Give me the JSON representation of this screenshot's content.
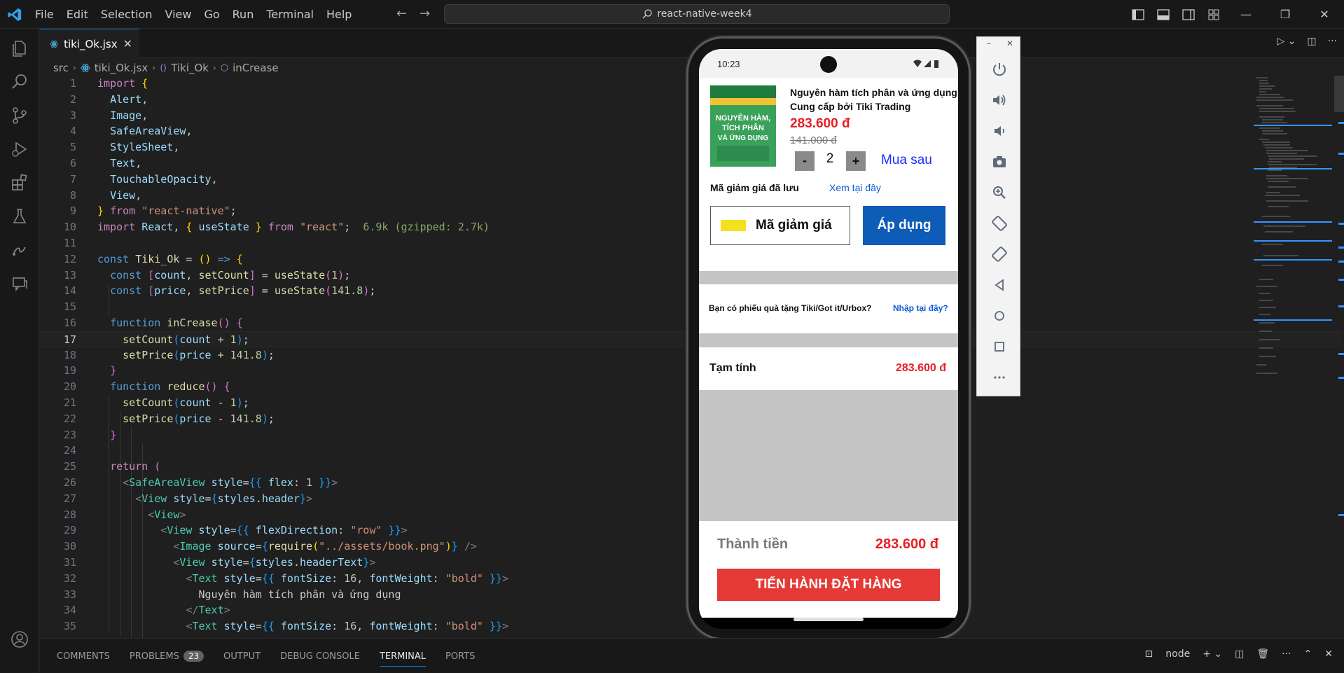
{
  "titlebar": {
    "menu": [
      "File",
      "Edit",
      "Selection",
      "View",
      "Go",
      "Run",
      "Terminal",
      "Help"
    ],
    "search": "react-native-week4"
  },
  "tab": {
    "filename": "tiki_Ok.jsx"
  },
  "breadcrumb": [
    "src",
    "tiki_Ok.jsx",
    "Tiki_Ok",
    "inCrease"
  ],
  "editor": {
    "line_numbers": [
      "1",
      "2",
      "3",
      "4",
      "5",
      "6",
      "7",
      "8",
      "9",
      "10",
      "11",
      "12",
      "13",
      "14",
      "15",
      "16",
      "17",
      "18",
      "19",
      "20",
      "21",
      "22",
      "23",
      "24",
      "25",
      "26",
      "27",
      "28",
      "29",
      "30",
      "31",
      "32",
      "33",
      "34",
      "35"
    ],
    "active_line": 17,
    "import_hint": "6.9k (gzipped: 2.7k)"
  },
  "panel": {
    "tabs": [
      "COMMENTS",
      "PROBLEMS",
      "OUTPUT",
      "DEBUG CONSOLE",
      "TERMINAL",
      "PORTS"
    ],
    "problems_count": "23",
    "active_tab": "TERMINAL",
    "terminal_name": "node"
  },
  "phone": {
    "time": "10:23",
    "product_title": "Nguyên hàm tích phân và ứng dụng",
    "provider": "Cung cấp bởi Tiki Trading",
    "price": "283.600 đ",
    "old_price": "141.000 đ",
    "minus": "-",
    "quantity": "2",
    "plus": "+",
    "buy_later": "Mua sau",
    "saved_coupon_label": "Mã giảm giá đã lưu",
    "saved_coupon_link": "Xem tại đây",
    "coupon_input": "Mã giảm giá",
    "apply_button": "Áp dụng",
    "gift_question": "Bạn có phiếu quà tặng Tiki/Got it/Urbox?",
    "gift_link": "Nhập tại đây?",
    "subtotal_label": "Tạm tính",
    "subtotal_value": "283.600 đ",
    "total_label": "Thành tiền",
    "total_value": "283.600 đ",
    "checkout_button": "TIẾN HÀNH ĐẶT HÀNG",
    "book_cover_title": "NGUYÊN HÀM, TÍCH PHÂN VÀ ỨNG DỤNG",
    "colors": {
      "price_red": "#e81e25",
      "link_blue": "#0d5bd8",
      "apply_blue": "#0d5cb6",
      "checkout_red": "#e53935",
      "coupon_yellow": "#f3e120"
    }
  },
  "emulator_toolbar": [
    "power-icon",
    "volume-up-icon",
    "volume-down-icon",
    "camera-icon",
    "zoom-icon",
    "rotate-left-icon",
    "rotate-right-icon",
    "back-icon",
    "home-icon",
    "overview-icon",
    "more-icon"
  ]
}
